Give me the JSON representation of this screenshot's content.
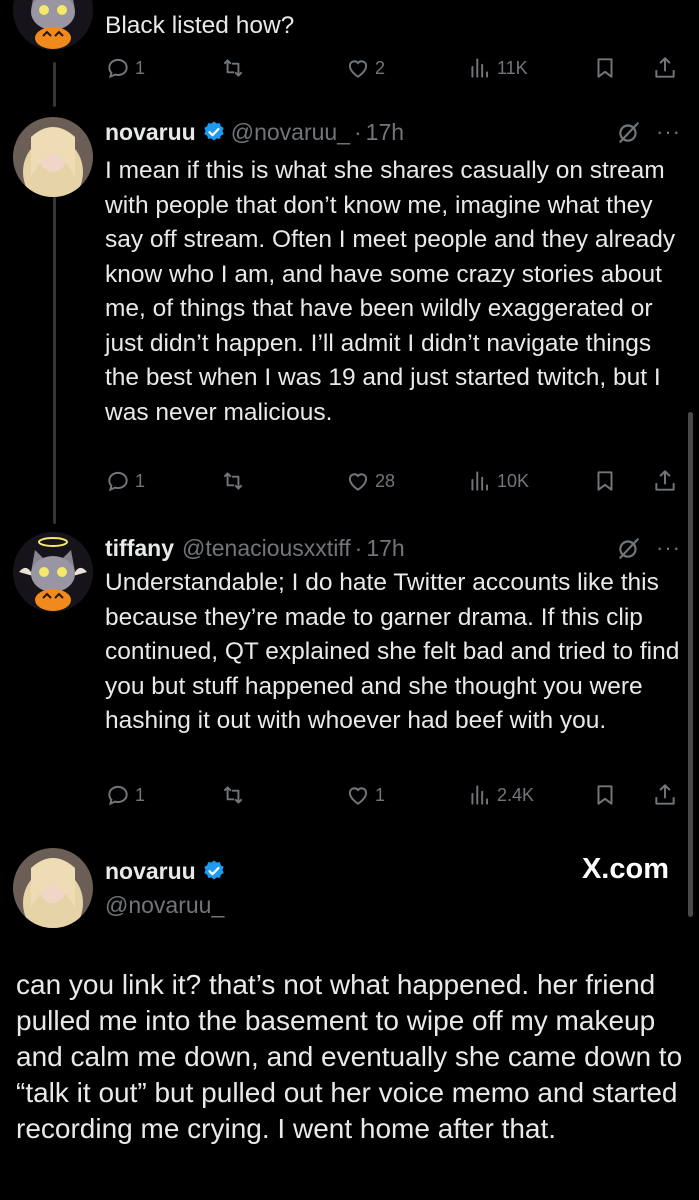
{
  "posts": [
    {
      "text": "Black listed how?",
      "stats": {
        "replies": "1",
        "reposts": "",
        "likes": "2",
        "views": "11K"
      }
    },
    {
      "name": "novaruu",
      "handle": "@novaruu_",
      "time": "17h",
      "verified": true,
      "text": "I mean if this is what she shares casually on stream with people that don’t know me, imagine what they say off stream. Often I meet people and they already know who I am, and have some crazy stories about me, of things that have been wildly exaggerated or just didn’t happen. I’ll admit I didn’t navigate things the best when I was 19 and just started twitch, but I was never malicious.",
      "stats": {
        "replies": "1",
        "reposts": "",
        "likes": "28",
        "views": "10K"
      }
    },
    {
      "name": "tiffany",
      "handle": "@tenaciousxxtiff",
      "time": "17h",
      "verified": false,
      "text": "Understandable; I do hate Twitter accounts like this because they’re made to garner drama. If this clip continued, QT explained she felt bad and tried to find you but stuff happened and she thought you were hashing it out with whoever had beef with you.",
      "stats": {
        "replies": "1",
        "reposts": "",
        "likes": "1",
        "views": "2.4K"
      }
    }
  ],
  "main_post": {
    "name": "novaruu",
    "handle": "@novaruu_",
    "verified": true,
    "watermark": "X.com",
    "text": "can you link it? that’s not what happened. her friend pulled me into the basement to wipe off my makeup and calm me down, and eventually she came down to “talk it out” but pulled out her voice memo and started recording me crying. I went home after that."
  },
  "colors": {
    "background": "#000000",
    "text": "#e7e9ea",
    "muted": "#71767b",
    "verified": "#1d9bf0",
    "thread_line": "#333639"
  },
  "icons": [
    "reply-icon",
    "repost-icon",
    "like-icon",
    "views-icon",
    "bookmark-icon",
    "share-icon",
    "grok-icon",
    "more-icon",
    "verified-badge-icon"
  ]
}
